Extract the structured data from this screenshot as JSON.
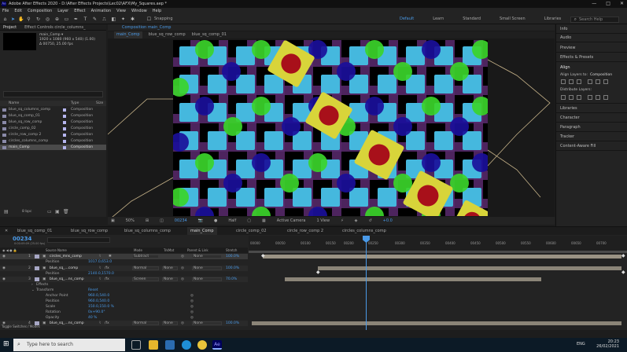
{
  "titlebar": {
    "app_icon": "Ae",
    "title": "Adobe After Effects 2020 - D:\\After Effects Projects\\Lec02\\AFX\\My_Squares.aep *",
    "min": "—",
    "max": "□",
    "close": "✕"
  },
  "menu": [
    "File",
    "Edit",
    "Composition",
    "Layer",
    "Effect",
    "Animation",
    "View",
    "Window",
    "Help"
  ],
  "toolbar": {
    "snapping": "Snapping",
    "workspaces": [
      "Default",
      "Learn",
      "Standard",
      "Small Screen",
      "Libraries"
    ],
    "active_workspace": "Default",
    "search_help": "Search Help"
  },
  "project": {
    "tabs": [
      "Project",
      "Effect Controls circle_columns_"
    ],
    "selected_name": "main_Comp ▾",
    "info_line1": "1920 x 1080 (960 x 540) (1.00)",
    "info_line2": "Δ 00750, 25.00 fps",
    "columns": [
      "Name",
      "Type",
      "Size"
    ],
    "items": [
      {
        "name": "blue_sq_columns_comp",
        "type": "Composition"
      },
      {
        "name": "blue_sq_comp_01",
        "type": "Composition"
      },
      {
        "name": "blue_sq_row_comp",
        "type": "Composition"
      },
      {
        "name": "circle_comp_02",
        "type": "Composition"
      },
      {
        "name": "circle_row_comp 2",
        "type": "Composition"
      },
      {
        "name": "circles_columns_comp",
        "type": "Composition"
      },
      {
        "name": "main_Comp",
        "type": "Composition"
      }
    ],
    "bpc": "8 bpc"
  },
  "composition": {
    "tab_label": "Composition main_Comp",
    "breadcrumbs": [
      "main_Comp",
      "blue_sq_row_comp",
      "blue_sq_comp_01"
    ],
    "viewer_bar": {
      "zoom": "50%",
      "timecode": "00234",
      "resolution": "Half",
      "camera": "Active Camera",
      "views": "1 View",
      "exposure": "+0.0"
    }
  },
  "right_panel": {
    "items": [
      "Info",
      "Audio",
      "Preview",
      "Effects & Presets",
      "Align"
    ],
    "align_to_label": "Align Layers to:",
    "align_to_value": "Composition",
    "distribute_label": "Distribute Layers:",
    "items_after": [
      "Libraries",
      "Character",
      "Paragraph",
      "Tracker",
      "Content-Aware Fill"
    ]
  },
  "timeline": {
    "tabs": [
      "blue_sq_comp_01",
      "blue_sq_row_comp",
      "blue_sq_columns_comp",
      "main_Comp",
      "circle_comp_02",
      "circle_row_comp 2",
      "circles_columns_comp"
    ],
    "active_tab": "main_Comp",
    "timecode": "00234",
    "timecode_sub": "0:00:09:09 (25.00 fps)",
    "header": {
      "name": "Source Name",
      "mode": "Mode",
      "trkmat": "TrkMat",
      "parent": "Parent & Link",
      "stretch": "Stretch"
    },
    "ruler": [
      "00000",
      "00050",
      "00100",
      "00150",
      "00200",
      "00250",
      "00300",
      "00350",
      "00400",
      "00450",
      "00500",
      "00550",
      "00600",
      "00650",
      "00700"
    ],
    "rows": [
      {
        "kind": "layer",
        "num": "1",
        "name": "circles_mns_comp",
        "mode": "Subtract",
        "trkmat": "",
        "parent": "None",
        "stretch": "100.0%"
      },
      {
        "kind": "prop",
        "name": "Position",
        "value": "1017.0,653.0"
      },
      {
        "kind": "layer",
        "num": "2",
        "name": "blue_sq_...comp",
        "mode": "Normal",
        "trkmat": "None",
        "parent": "None",
        "stretch": "100.0%"
      },
      {
        "kind": "prop",
        "name": "Position",
        "value": "2140.0,1570.0"
      },
      {
        "kind": "layer",
        "num": "3",
        "name": "blue_sq_...ns_comp",
        "mode": "Screen",
        "trkmat": "None",
        "parent": "None",
        "stretch": "70.0%"
      },
      {
        "kind": "group",
        "name": "Effects",
        "value": ""
      },
      {
        "kind": "group",
        "name": "Transform",
        "value": "Reset"
      },
      {
        "kind": "prop",
        "name": "Anchor Point",
        "value": "960.0,540.0"
      },
      {
        "kind": "prop",
        "name": "Position",
        "value": "960.0,540.0"
      },
      {
        "kind": "prop",
        "name": "Scale",
        "value": "150.0,150.0 %"
      },
      {
        "kind": "prop",
        "name": "Rotation",
        "value": "0x+90.0°"
      },
      {
        "kind": "prop",
        "name": "Opacity",
        "value": "40 %"
      },
      {
        "kind": "layer",
        "num": "4",
        "name": "blue_sq_...ns_comp",
        "mode": "Normal",
        "trkmat": "None",
        "parent": "None",
        "stretch": "100.0%"
      }
    ],
    "toggle": "Toggle Switches / Modes"
  },
  "taskbar": {
    "search_placeholder": "Type here to search",
    "lang": "ENG",
    "time": "20:23",
    "date": "26/02/2021"
  },
  "colors": {
    "accent": "#4a9ae8",
    "cyan_square": "#45b8de",
    "purple_grid": "#5b2a6e",
    "green_circle": "#3bd42a",
    "dark_blue_circle": "#1a0f9a",
    "yellow_square": "#d8d43a",
    "red_circle": "#a8101a"
  },
  "icons": [
    "ae-app-icon",
    "home-icon",
    "selection-tool-icon",
    "hand-tool-icon",
    "zoom-tool-icon",
    "windows-start-icon",
    "search-icon",
    "task-view-icon",
    "file-explorer-icon",
    "edge-icon",
    "chrome-icon",
    "after-effects-icon"
  ]
}
